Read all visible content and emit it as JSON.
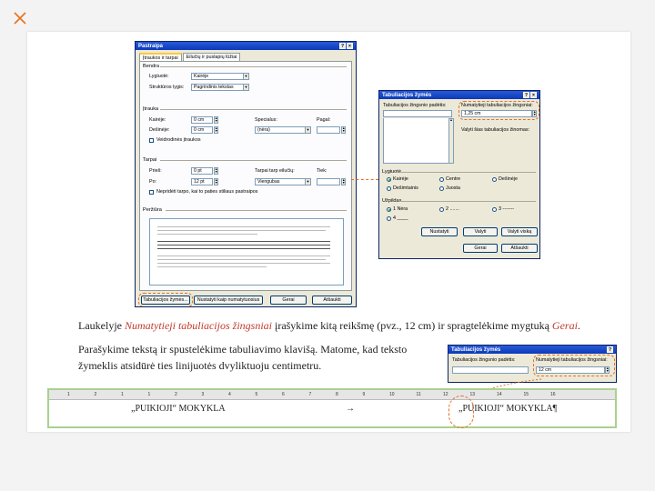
{
  "main_dialog": {
    "title": "Pastraipa",
    "tabs": [
      "Įtraukos ir tarpai",
      "Eilučių ir puslapių lūžiai"
    ],
    "general_section": "Bendra",
    "alignment_label": "Lygiuotė:",
    "alignment_value": "Kairėje",
    "outline_label": "Struktūros lygis:",
    "outline_value": "Pagrindinis tekstas",
    "indent_section": "Įtrauka",
    "left_label": "Kairėje:",
    "left_value": "0 cm",
    "right_label": "Dešinėje:",
    "right_value": "0 cm",
    "special_label": "Specialus:",
    "special_value": "(nėra)",
    "by_label": "Pagal:",
    "mirror_label": "Veidrodinės įtraukos",
    "spacing_section": "Tarpai",
    "before_label": "Prieš:",
    "before_value": "0 pt",
    "after_label": "Po:",
    "after_value": "12 pt",
    "line_spacing_label": "Tarpai tarp eilučių:",
    "line_spacing_value": "Viengubas",
    "at_label": "Tiek:",
    "no_space_label": "Nepridėti tarpo, kai to paties stiliaus pastraipos",
    "preview_section": "Peržiūra",
    "buttons": [
      "Tabuliacijos žymės...",
      "Nustatyti kaip numatytuosius",
      "Gerai",
      "Atšaukti"
    ]
  },
  "tab_dialog": {
    "title": "Tabuliacijos žymės",
    "stop_position_label": "Tabuliacijos žingsnio padėtis:",
    "default_stops_label": "Numatytieji tabuliacijos žingsniai:",
    "default_stops_value": "1,25 cm",
    "to_clear_label": "Valyti šias tabuliacijos žinomas:",
    "alignment_section": "Lygiuotė",
    "alignment_options": [
      "Kairėje",
      "Centre",
      "Dešinėje",
      "Dešimtainis",
      "Juosta"
    ],
    "leader_section": "Užpildas",
    "leader_options": [
      "1 Nėra",
      "2 .......",
      "3 -------",
      "4 ____"
    ],
    "buttons": [
      "Nustatyti",
      "Valyti",
      "Valyti viską",
      "Gerai",
      "Atšaukti"
    ]
  },
  "instruction_line": {
    "prefix": "Laukelyje ",
    "field_name": "Numatytieji tabuliacijos žingsniai",
    "middle": " įrašykime kitą reikšmę (pvz., 12 cm) ir spragtelėkime mygtuką ",
    "button_name": "Gerai",
    "suffix": "."
  },
  "instruction_text_1": "Parašykime tekstą ir spustelėkime tabuliavimo klavišą. Matome, kad teksto",
  "instruction_text_2": "žymeklis atsidūrė ties linijuotės dvyliktuoju centimetru.",
  "small_dialog": {
    "title": "Tabuliacijos žymės",
    "stop_position_label": "Tabuliacijos žingsnio padėtis:",
    "default_stops_label": "Numatytieji tabuliacijos žingsniai:",
    "default_stops_value": "12 cm"
  },
  "ruler_numbers": [
    "1",
    "2",
    "1",
    "1",
    "2",
    "3",
    "4",
    "5",
    "6",
    "7",
    "8",
    "9",
    "10",
    "11",
    "12",
    "13",
    "14",
    "15",
    "16"
  ],
  "document_text_left": "„PUIKIOJI“ MOKYKLA",
  "tab_arrow": "→",
  "document_text_right": "„PUIKIOJI“ MOKYKLA¶",
  "colors": {
    "accent": "#e8701a",
    "highlight_red": "#c0392b",
    "frame_green": "#a9d18e"
  }
}
